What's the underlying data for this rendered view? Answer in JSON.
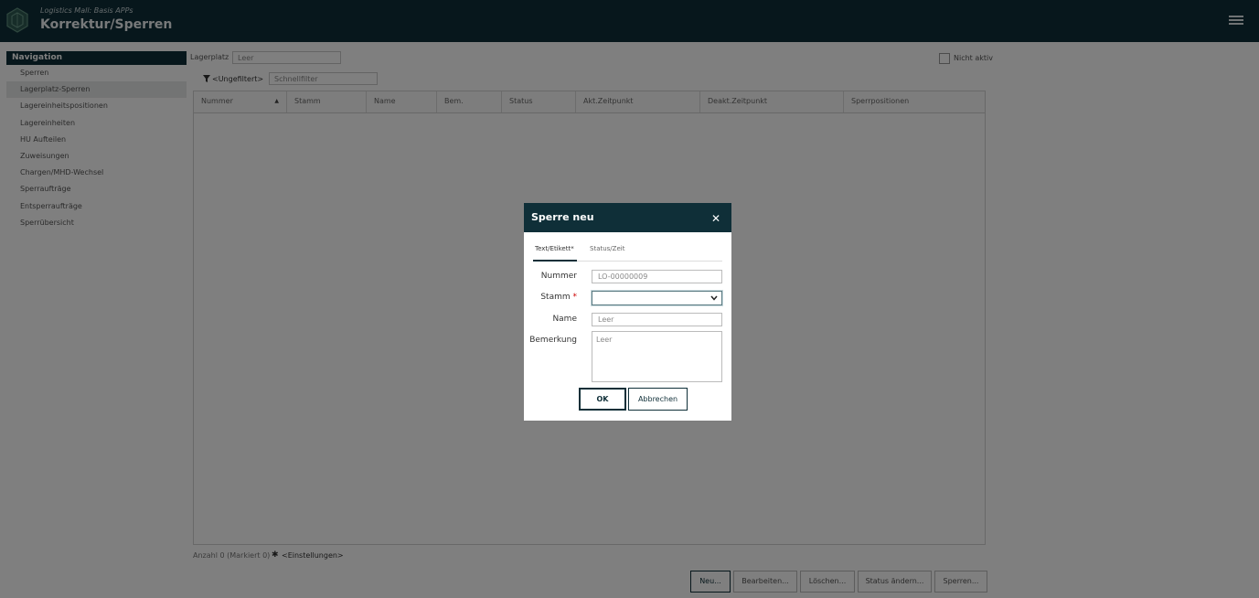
{
  "header": {
    "subtitle": "Logistics Mall: Basis APPs",
    "title": "Korrektur/Sperren"
  },
  "navigation": {
    "title": "Navigation",
    "items": [
      {
        "label": "Sperren",
        "active": false
      },
      {
        "label": "Lagerplatz-Sperren",
        "active": true
      },
      {
        "label": "Lagereinheitspositionen",
        "active": false
      },
      {
        "label": "Lagereinheiten",
        "active": false
      },
      {
        "label": "HU Aufteilen",
        "active": false
      },
      {
        "label": "Zuweisungen",
        "active": false
      },
      {
        "label": "Chargen/MHD-Wechsel",
        "active": false
      },
      {
        "label": "Sperraufträge",
        "active": false
      },
      {
        "label": "Entsperraufträge",
        "active": false
      },
      {
        "label": "Sperrübersicht",
        "active": false
      }
    ]
  },
  "filters": {
    "lagerplatz_label": "Lagerplatz",
    "lagerplatz_placeholder": "Leer",
    "nicht_aktiv_label": "Nicht aktiv",
    "filter_label": "<Ungefiltert>",
    "quick_filter_placeholder": "Schnellfilter"
  },
  "table": {
    "columns": [
      "Nummer",
      "Stamm",
      "Name",
      "Bem.",
      "Status",
      "Akt.Zeitpunkt",
      "Deakt.Zeitpunkt",
      "Sperrpositionen"
    ],
    "rows": []
  },
  "footer": {
    "count": "Anzahl 0 (Markiert 0)",
    "settings": "<Einstellungen>"
  },
  "actions": [
    "Neu...",
    "Bearbeiten...",
    "Löschen...",
    "Status ändern...",
    "Sperren..."
  ],
  "dialog": {
    "title": "Sperre neu",
    "tabs": [
      "Text/Etikett*",
      "Status/Zeit"
    ],
    "fields": {
      "nummer_label": "Nummer",
      "nummer_value": "LO-00000009",
      "stamm_label": "Stamm",
      "stamm_required": "*",
      "stamm_value": "",
      "name_label": "Name",
      "name_placeholder": "Leer",
      "bemerkung_label": "Bemerkung",
      "bemerkung_placeholder": "Leer"
    },
    "ok_label": "OK",
    "cancel_label": "Abbrechen"
  },
  "colors": {
    "primary": "#0f2f38",
    "required": "#cc0000"
  }
}
